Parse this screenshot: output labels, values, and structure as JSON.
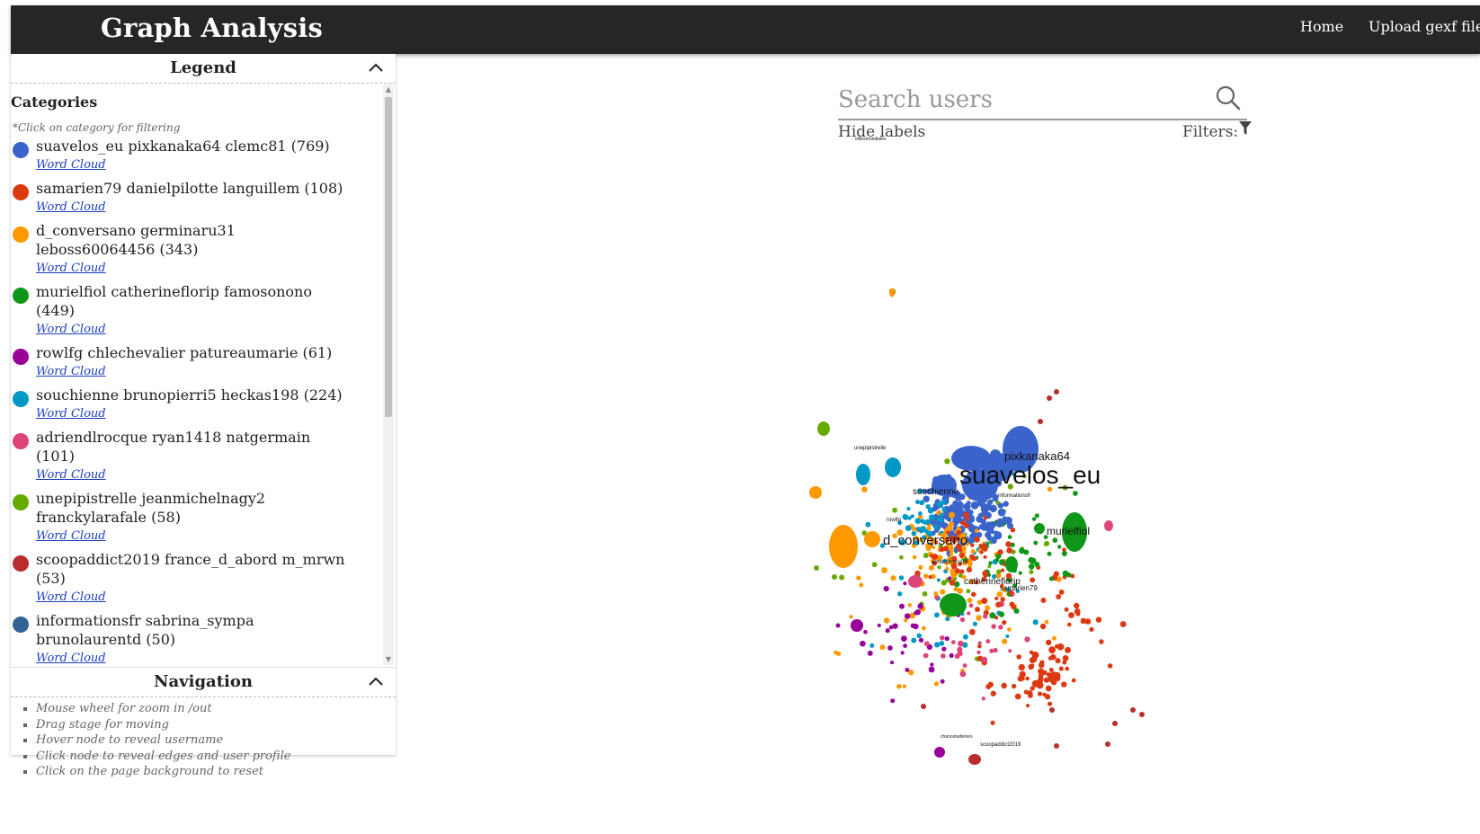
{
  "header": {
    "title": "Graph Analysis",
    "nav": {
      "home": "Home",
      "upload": "Upload gexf file"
    }
  },
  "legend": {
    "title": "Legend",
    "categories_title": "Categories",
    "hint": "*Click on category for filtering",
    "word_cloud_label": "Word Cloud",
    "items": [
      {
        "label": "suavelos_eu pixkanaka64 clemc81 (769)",
        "color": "#3a64cc"
      },
      {
        "label": "samarien79 danielpilotte languillem (108)",
        "color": "#dc3912"
      },
      {
        "label": "d_conversano germinaru31 leboss60064456 (343)",
        "color": "#ff9900"
      },
      {
        "label": "murielfiol catherineflorip famosonono (449)",
        "color": "#109618"
      },
      {
        "label": "rowlfg chlechevalier patureaumarie (61)",
        "color": "#990099"
      },
      {
        "label": "souchienne brunopierri5 heckas198 (224)",
        "color": "#0099c6"
      },
      {
        "label": "adriendlrocque ryan1418 natgermain (101)",
        "color": "#dd4477"
      },
      {
        "label": "unepipistrelle jeanmichelnagy2 franckylarafale (58)",
        "color": "#66aa00"
      },
      {
        "label": "scoopaddict2019 france_d_abord m_mrwn (53)",
        "color": "#b82e2e"
      },
      {
        "label": "informationsfr sabrina_sympa brunolaurentd (50)",
        "color": "#316395"
      }
    ]
  },
  "navigation": {
    "title": "Navigation",
    "items": [
      "Mouse wheel for zoom in /out",
      "Drag stage for moving",
      "Hover node to reveal username",
      "Click node to reveal edges and user profile",
      "Click on the page background to reset"
    ]
  },
  "search": {
    "placeholder": "Search users"
  },
  "controls": {
    "hide_labels": "Hide labels",
    "filters": "Filters:"
  },
  "graph": {
    "labels": [
      "suavelos_eu",
      "pixkanaka64",
      "d_conversano",
      "murielfiol",
      "catherineflorip",
      "samarien79",
      "souchienne",
      "unepipistrelle",
      "informationsfr",
      "scoopaddict2019",
      "chanceladivines",
      "adriendlrocque",
      "elitesmondiales",
      "rowlfg"
    ]
  }
}
